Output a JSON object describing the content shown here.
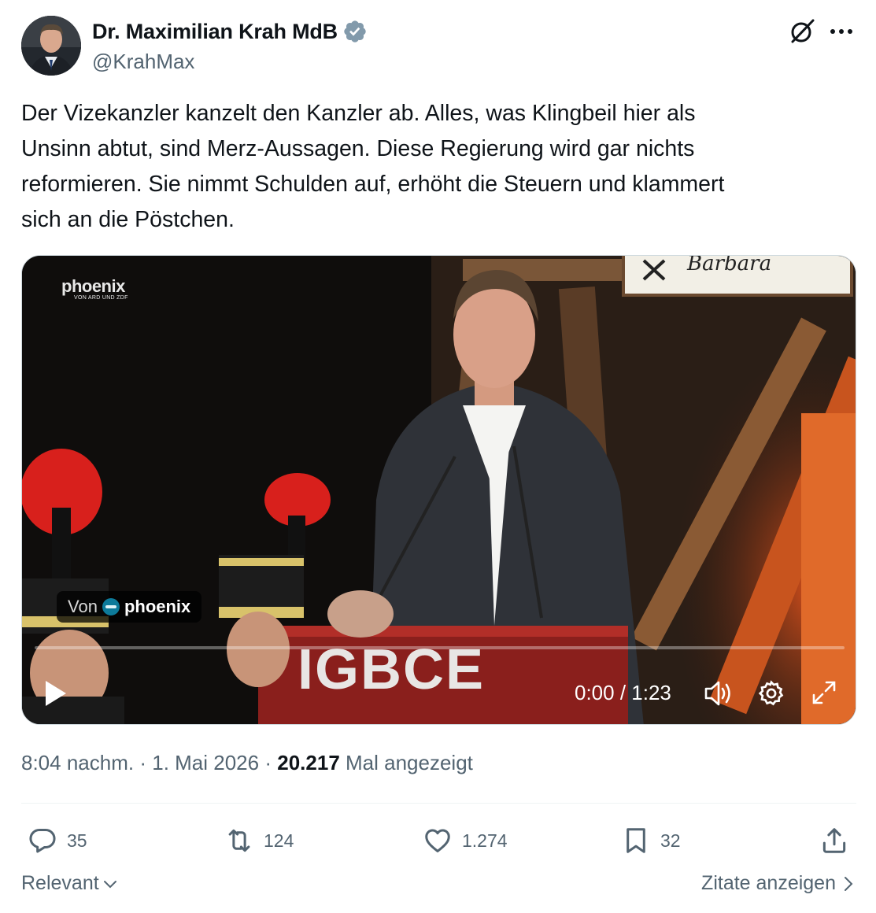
{
  "author": {
    "display_name": "Dr. Maximilian Krah MdB",
    "handle": "@KrahMax",
    "verified": true,
    "verified_color": "#829aab"
  },
  "tweet": {
    "text": "Der Vizekanzler kanzelt den Kanzler ab. Alles, was Klingbeil hier als\nUnsinn abtut, sind Merz-Aussagen. Diese Regierung wird gar nichts\nreformieren. Sie nimmt Schulden auf, erhöht die Steuern und klammert\nsich an die Pöstchen."
  },
  "video": {
    "channel_logo_text": "phoenix",
    "channel_logo_subtext": "VON ARD UND ZDF",
    "source_prefix": "Von",
    "source_name": "phoenix",
    "podium_text": "IGBCE",
    "sign_text": "Barbara",
    "time": "0:00 / 1:23",
    "progress": 0
  },
  "meta": {
    "time": "8:04 nachm.",
    "separator": "·",
    "date": "1. Mai 2026",
    "views_count": "20.217",
    "views_label": "Mal angezeigt"
  },
  "actions": {
    "replies": "35",
    "reposts": "124",
    "likes": "1.274",
    "bookmarks": "32"
  },
  "footer": {
    "sort_label": "Relevant",
    "quotes_label": "Zitate anzeigen"
  },
  "icons": {
    "grok": "grok-icon",
    "more": "more-icon",
    "reply": "reply-icon",
    "repost": "repost-icon",
    "like": "heart-icon",
    "bookmark": "bookmark-icon",
    "share": "share-icon",
    "play": "play-icon",
    "volume": "volume-icon",
    "settings": "gear-icon",
    "fullscreen": "fullscreen-icon"
  }
}
